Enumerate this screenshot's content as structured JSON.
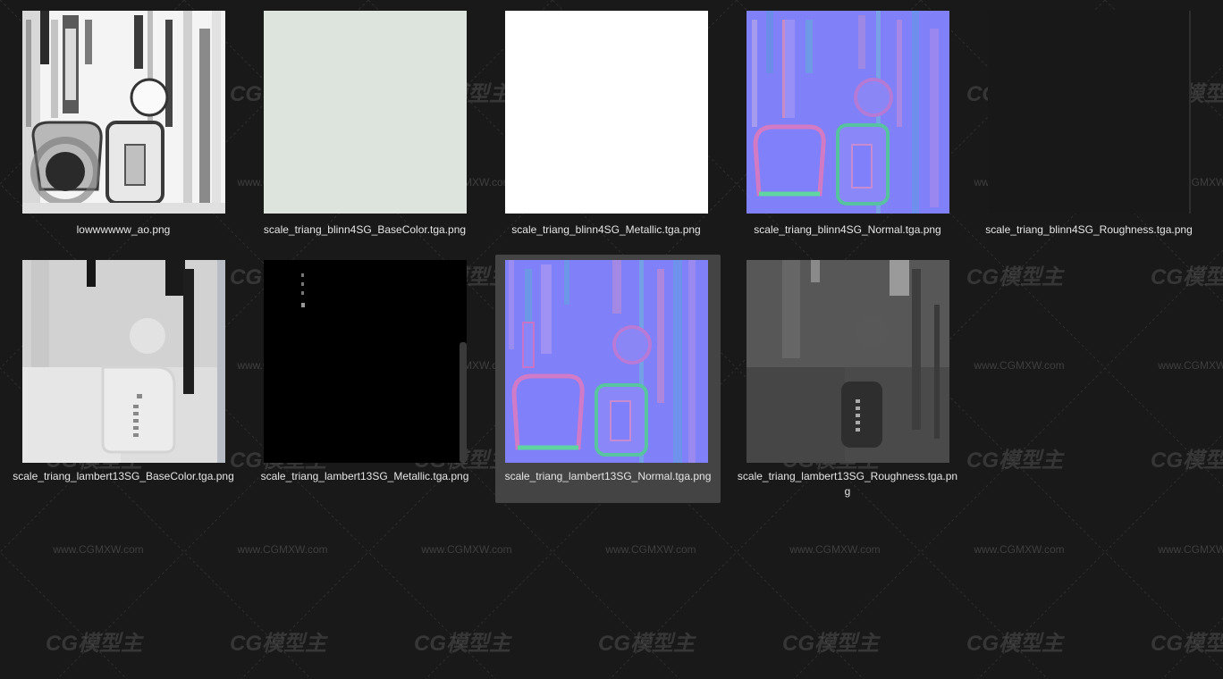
{
  "files": [
    {
      "name": "lowwwwww_ao.png",
      "thumbnail": "ao-map",
      "selected": false
    },
    {
      "name": "scale_triang_blinn4SG_BaseColor.tga.png",
      "thumbnail": "flat-pale-green",
      "selected": false
    },
    {
      "name": "scale_triang_blinn4SG_Metallic.tga.png",
      "thumbnail": "flat-white",
      "selected": false
    },
    {
      "name": "scale_triang_blinn4SG_Normal.tga.png",
      "thumbnail": "normal-map",
      "selected": false
    },
    {
      "name": "scale_triang_blinn4SG_Roughness.tga.png",
      "thumbnail": "flat-black",
      "selected": false
    },
    {
      "name": "scale_triang_lambert13SG_BaseColor.tga.png",
      "thumbnail": "basecolor-light-gray",
      "selected": false
    },
    {
      "name": "scale_triang_lambert13SG_Metallic.tga.png",
      "thumbnail": "metallic-black",
      "selected": false
    },
    {
      "name": "scale_triang_lambert13SG_Normal.tga.png",
      "thumbnail": "normal-map",
      "selected": true
    },
    {
      "name": "scale_triang_lambert13SG_Roughness.tga.png",
      "thumbnail": "roughness-gray",
      "selected": false
    }
  ],
  "colors": {
    "background": "#191919",
    "selection": "#444444",
    "text": "#e6e6e6",
    "normal_base": "#8080ff"
  },
  "watermark": {
    "logo_text": "CG模型主",
    "url_text": "www.CGMXW.com"
  }
}
